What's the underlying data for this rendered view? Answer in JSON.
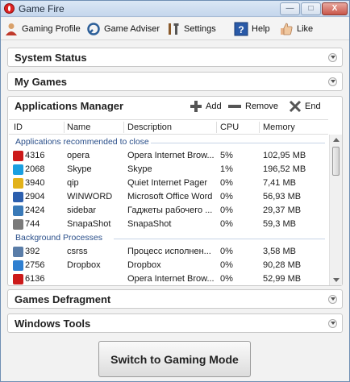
{
  "window": {
    "title": "Game Fire",
    "controls": {
      "minimize": "—",
      "maximize": "□",
      "close": "X"
    }
  },
  "toolbar": {
    "items": [
      {
        "label": "Gaming Profile",
        "icon": "user-icon"
      },
      {
        "label": "Game Adviser",
        "icon": "adviser-icon"
      },
      {
        "label": "Settings",
        "icon": "tools-icon"
      },
      {
        "label": "Help",
        "icon": "help-icon"
      },
      {
        "label": "Like",
        "icon": "thumbs-up-icon"
      }
    ]
  },
  "sections": {
    "system_status": "System Status",
    "my_games": "My Games",
    "games_defragment": "Games Defragment",
    "windows_tools": "Windows Tools"
  },
  "apps_manager": {
    "title": "Applications Manager",
    "actions": {
      "add": "Add",
      "remove": "Remove",
      "end": "End"
    },
    "columns": [
      "ID",
      "Name",
      "Description",
      "CPU",
      "Memory"
    ],
    "groups": [
      {
        "label": "Applications recommended to close",
        "rows": [
          {
            "id": "4316",
            "name": "opera",
            "description": "Opera Internet Brow...",
            "cpu": "5%",
            "memory": "102,95 MB",
            "icon": "opera-icon",
            "color": "#cc1a1a"
          },
          {
            "id": "2068",
            "name": "Skype",
            "description": "Skype",
            "cpu": "1%",
            "memory": "196,52 MB",
            "icon": "skype-icon",
            "color": "#1a9fe0"
          },
          {
            "id": "3940",
            "name": "qip",
            "description": "Quiet Internet Pager",
            "cpu": "0%",
            "memory": "7,41 MB",
            "icon": "qip-icon",
            "color": "#e2b21a"
          },
          {
            "id": "2904",
            "name": "WINWORD",
            "description": "Microsoft Office Word",
            "cpu": "0%",
            "memory": "56,93 MB",
            "icon": "word-icon",
            "color": "#2c5fae"
          },
          {
            "id": "2424",
            "name": "sidebar",
            "description": "Гаджеты рабочего ...",
            "cpu": "0%",
            "memory": "29,37 MB",
            "icon": "sidebar-icon",
            "color": "#3a7ab8"
          },
          {
            "id": "744",
            "name": "SnapaShot",
            "description": "SnapaShot",
            "cpu": "0%",
            "memory": "59,3 MB",
            "icon": "snapashot-icon",
            "color": "#7a7a7a"
          }
        ]
      },
      {
        "label": "Background Processes",
        "rows": [
          {
            "id": "392",
            "name": "csrss",
            "description": "Процесс исполнен...",
            "cpu": "0%",
            "memory": "3,58 MB",
            "icon": "process-icon",
            "color": "#5a7da8"
          },
          {
            "id": "2756",
            "name": "Dropbox",
            "description": "Dropbox",
            "cpu": "0%",
            "memory": "90,28 MB",
            "icon": "dropbox-icon",
            "color": "#2f7fd0"
          },
          {
            "id": "6136",
            "name": "",
            "description": "Opera Internet Brow...",
            "cpu": "0%",
            "memory": "52,99 MB",
            "icon": "opera-icon",
            "color": "#cc1a1a"
          }
        ]
      }
    ]
  },
  "gaming_mode_button": "Switch to Gaming Mode"
}
